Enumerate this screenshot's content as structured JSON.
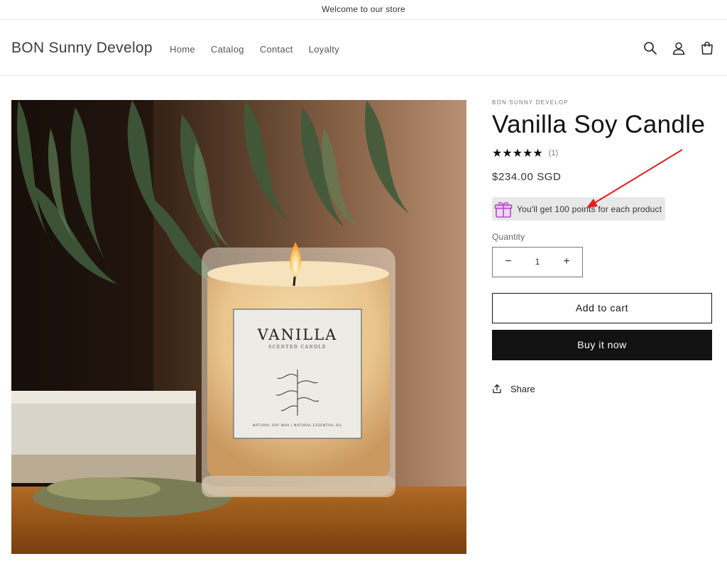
{
  "announcement": {
    "text": "Welcome to our store"
  },
  "header": {
    "logo": "BON Sunny Develop",
    "nav": [
      "Home",
      "Catalog",
      "Contact",
      "Loyalty"
    ],
    "icons": [
      "search-icon",
      "account-icon",
      "cart-icon"
    ]
  },
  "product": {
    "vendor": "BON SUNNY DEVELOP",
    "title": "Vanilla Soy Candle",
    "rating": {
      "stars": "★★★★★",
      "value": 5,
      "count": "(1)"
    },
    "price": "$234.00 SGD",
    "points_text": "You'll get 100 points for each product",
    "quantity_label": "Quantity",
    "quantity_value": "1",
    "decrease_symbol": "−",
    "increase_symbol": "+",
    "add_to_cart": "Add to cart",
    "buy_now": "Buy it now",
    "share": "Share"
  },
  "image": {
    "label_main": "VANILLA",
    "label_sub": "SCENTED CANDLE",
    "label_footer": "NATURAL SOY WAX  |  NATURAL ESSENTIAL OIL"
  },
  "colors": {
    "accent": "#121212",
    "annotation_arrow": "#e02020",
    "points_bg": "#e8e8e8"
  }
}
